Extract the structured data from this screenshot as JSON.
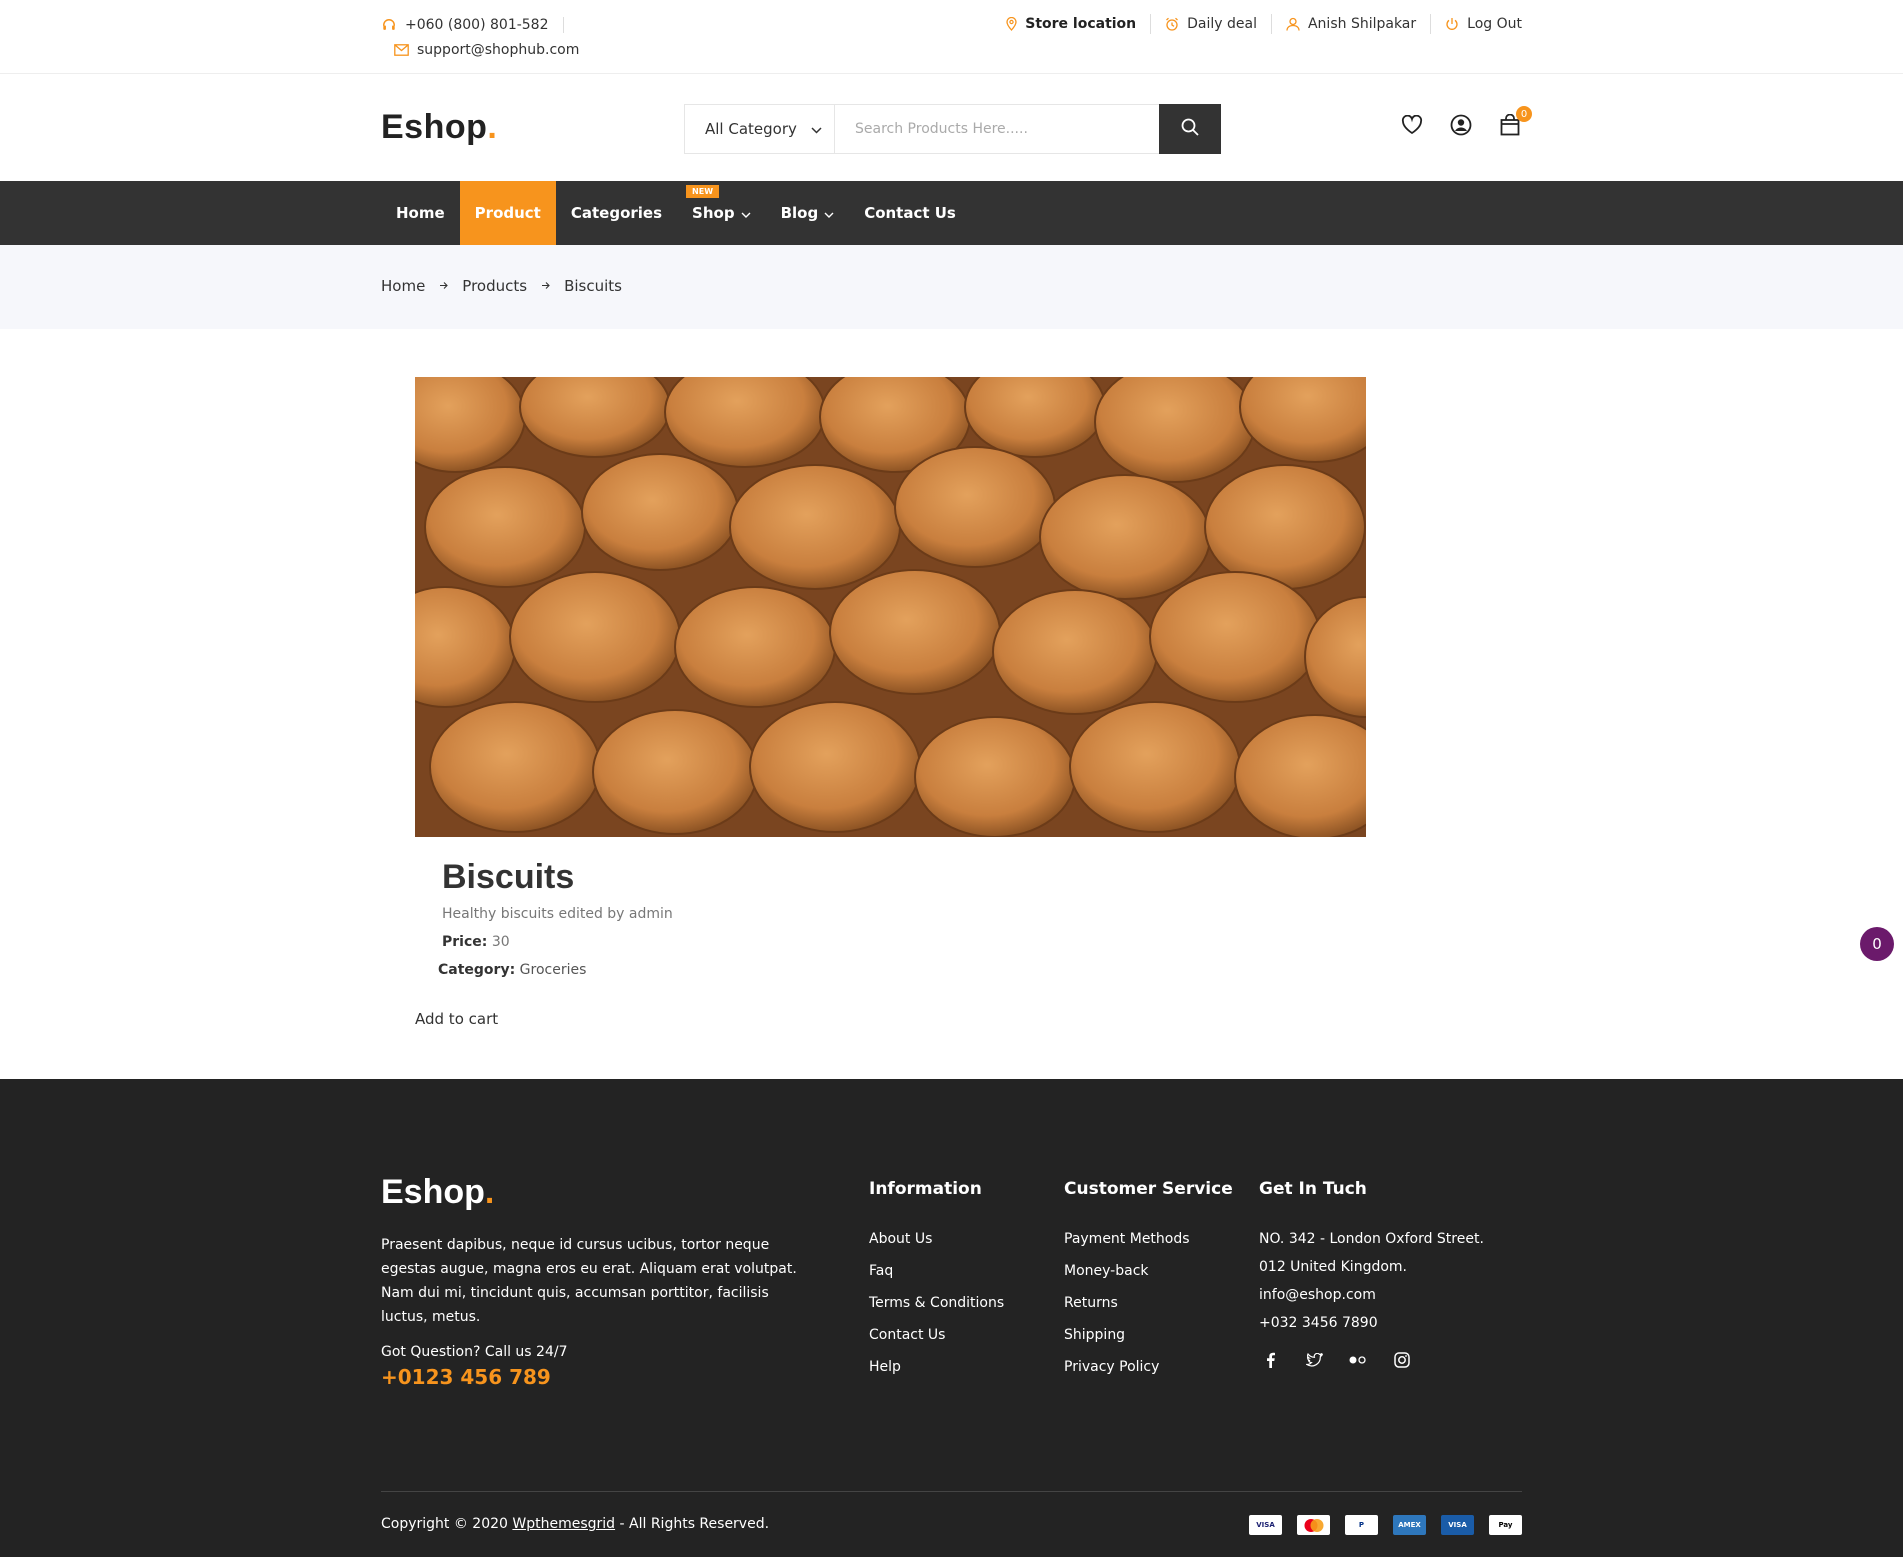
{
  "topbar": {
    "phone": "+060 (800) 801-582",
    "email": "support@shophub.com",
    "store_location": "Store location",
    "daily_deal": "Daily deal",
    "user_name": "Anish Shilpakar",
    "logout": "Log Out"
  },
  "header": {
    "logo_text": "Eshop",
    "logo_dot": ".",
    "category_select": "All Category",
    "search_placeholder": "Search Products Here.....",
    "cart_count": "0"
  },
  "nav": {
    "items": [
      {
        "label": "Home"
      },
      {
        "label": "Product",
        "active": true
      },
      {
        "label": "Categories"
      },
      {
        "label": "Shop",
        "badge": "NEW"
      },
      {
        "label": "Blog"
      },
      {
        "label": "Contact Us"
      }
    ]
  },
  "breadcrumb": [
    "Home",
    "Products",
    "Biscuits"
  ],
  "product": {
    "title": "Biscuits",
    "description": "Healthy biscuits edited by admin",
    "price_label": "Price:",
    "price_value": "30",
    "category_label": "Category:",
    "category_value": "Groceries",
    "add_to_cart": "Add to cart"
  },
  "floating_badge": "0",
  "footer": {
    "logo_text": "Eshop",
    "logo_dot": ".",
    "about": "Praesent dapibus, neque id cursus ucibus, tortor neque egestas augue, magna eros eu erat. Aliquam erat volutpat. Nam dui mi, tincidunt quis, accumsan porttitor, facilisis luctus, metus.",
    "question": "Got Question? Call us 24/7",
    "phone": "+0123 456 789",
    "information": {
      "title": "Information",
      "links": [
        "About Us",
        "Faq",
        "Terms & Conditions",
        "Contact Us",
        "Help"
      ]
    },
    "customer_service": {
      "title": "Customer Service",
      "links": [
        "Payment Methods",
        "Money-back",
        "Returns",
        "Shipping",
        "Privacy Policy"
      ]
    },
    "get_in_touch": {
      "title": "Get In Tuch",
      "lines": [
        "NO. 342 - London Oxford Street.",
        "012 United Kingdom.",
        "info@eshop.com",
        "+032 3456 7890"
      ]
    },
    "copyright_prefix": "Copyright © 2020 ",
    "copyright_link": "Wpthemesgrid",
    "copyright_suffix": " - All Rights Reserved.",
    "payment_icons": [
      "visa-icon",
      "mastercard-icon",
      "paypal-icon",
      "american-express-icon",
      "visa-icon",
      "apple-pay-icon"
    ]
  },
  "colors": {
    "accent": "#f7941d",
    "nav_bg": "#333333",
    "footer_bg": "#232323",
    "breadcrumb_bg": "#f6f7fb",
    "floating_badge": "#6b1a6b"
  }
}
